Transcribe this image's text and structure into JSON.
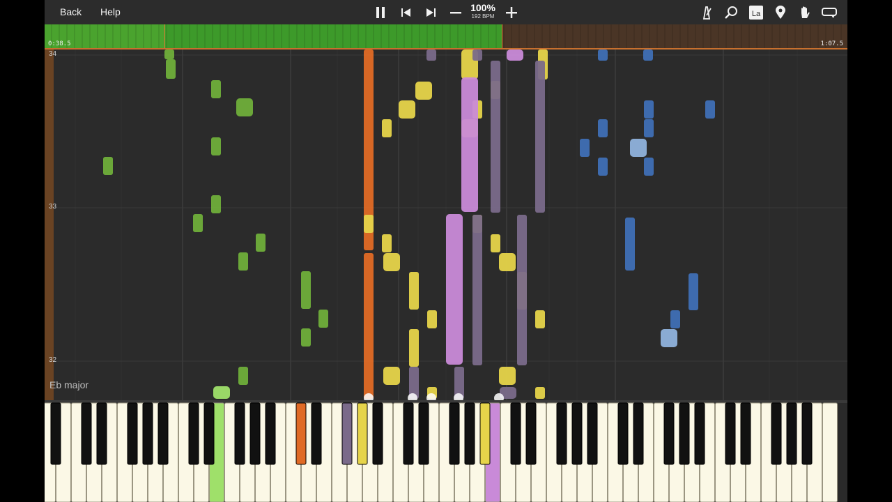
{
  "toolbar": {
    "back_label": "Back",
    "help_label": "Help",
    "speed_percent": "100%",
    "speed_bpm": "192 BPM",
    "icons": [
      "pause-icon",
      "previous-icon",
      "next-icon",
      "minus-icon",
      "plus-icon",
      "metronome-icon",
      "search-icon",
      "note-label-icon",
      "location-pin-icon",
      "hand-icon",
      "loop-icon"
    ]
  },
  "timeline": {
    "start_time": "0:38.5",
    "end_time": "1:07.5",
    "progress_fraction": 0.57,
    "section_start_fraction": 0.149,
    "played_color": "#4aa32e",
    "remaining_color": "#4a3526"
  },
  "roll": {
    "measures": [
      "34",
      "33",
      "32"
    ],
    "key_signature": "Eb major",
    "colors": {
      "green": "#6fae3a",
      "green_light": "#9fe06a",
      "orange": "#e06a25",
      "yellow": "#e6d44a",
      "yellow_bright": "#f6e25e",
      "purple": "#c98ad8",
      "purple_dark": "#7a6a8a",
      "blue": "#3f6fb5",
      "blue_light": "#8fb2dc"
    }
  },
  "keyboard": {
    "white_key_color": "#fbf8e6",
    "black_key_color": "#111111",
    "pressed_keys": [
      "green",
      "orange",
      "purple",
      "yellow"
    ]
  }
}
